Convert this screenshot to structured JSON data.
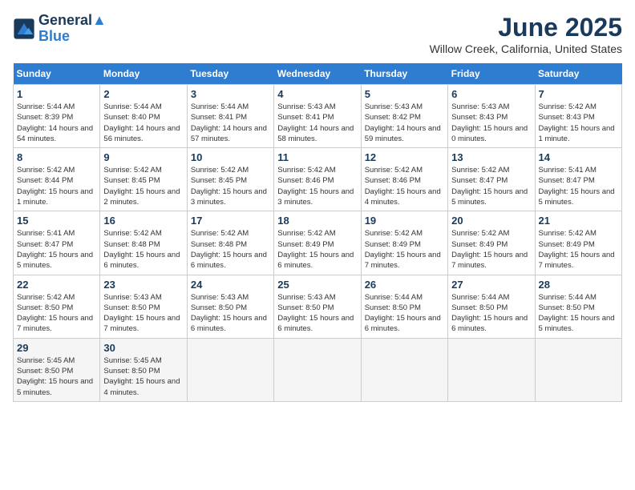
{
  "logo": {
    "line1": "General",
    "line2": "Blue"
  },
  "title": "June 2025",
  "location": "Willow Creek, California, United States",
  "weekdays": [
    "Sunday",
    "Monday",
    "Tuesday",
    "Wednesday",
    "Thursday",
    "Friday",
    "Saturday"
  ],
  "weeks": [
    [
      {
        "day": "1",
        "sunrise": "5:44 AM",
        "sunset": "8:39 PM",
        "daylight": "14 hours and 54 minutes."
      },
      {
        "day": "2",
        "sunrise": "5:44 AM",
        "sunset": "8:40 PM",
        "daylight": "14 hours and 56 minutes."
      },
      {
        "day": "3",
        "sunrise": "5:44 AM",
        "sunset": "8:41 PM",
        "daylight": "14 hours and 57 minutes."
      },
      {
        "day": "4",
        "sunrise": "5:43 AM",
        "sunset": "8:41 PM",
        "daylight": "14 hours and 58 minutes."
      },
      {
        "day": "5",
        "sunrise": "5:43 AM",
        "sunset": "8:42 PM",
        "daylight": "14 hours and 59 minutes."
      },
      {
        "day": "6",
        "sunrise": "5:43 AM",
        "sunset": "8:43 PM",
        "daylight": "15 hours and 0 minutes."
      },
      {
        "day": "7",
        "sunrise": "5:42 AM",
        "sunset": "8:43 PM",
        "daylight": "15 hours and 1 minute."
      }
    ],
    [
      {
        "day": "8",
        "sunrise": "5:42 AM",
        "sunset": "8:44 PM",
        "daylight": "15 hours and 1 minute."
      },
      {
        "day": "9",
        "sunrise": "5:42 AM",
        "sunset": "8:45 PM",
        "daylight": "15 hours and 2 minutes."
      },
      {
        "day": "10",
        "sunrise": "5:42 AM",
        "sunset": "8:45 PM",
        "daylight": "15 hours and 3 minutes."
      },
      {
        "day": "11",
        "sunrise": "5:42 AM",
        "sunset": "8:46 PM",
        "daylight": "15 hours and 3 minutes."
      },
      {
        "day": "12",
        "sunrise": "5:42 AM",
        "sunset": "8:46 PM",
        "daylight": "15 hours and 4 minutes."
      },
      {
        "day": "13",
        "sunrise": "5:42 AM",
        "sunset": "8:47 PM",
        "daylight": "15 hours and 5 minutes."
      },
      {
        "day": "14",
        "sunrise": "5:41 AM",
        "sunset": "8:47 PM",
        "daylight": "15 hours and 5 minutes."
      }
    ],
    [
      {
        "day": "15",
        "sunrise": "5:41 AM",
        "sunset": "8:47 PM",
        "daylight": "15 hours and 5 minutes."
      },
      {
        "day": "16",
        "sunrise": "5:42 AM",
        "sunset": "8:48 PM",
        "daylight": "15 hours and 6 minutes."
      },
      {
        "day": "17",
        "sunrise": "5:42 AM",
        "sunset": "8:48 PM",
        "daylight": "15 hours and 6 minutes."
      },
      {
        "day": "18",
        "sunrise": "5:42 AM",
        "sunset": "8:49 PM",
        "daylight": "15 hours and 6 minutes."
      },
      {
        "day": "19",
        "sunrise": "5:42 AM",
        "sunset": "8:49 PM",
        "daylight": "15 hours and 7 minutes."
      },
      {
        "day": "20",
        "sunrise": "5:42 AM",
        "sunset": "8:49 PM",
        "daylight": "15 hours and 7 minutes."
      },
      {
        "day": "21",
        "sunrise": "5:42 AM",
        "sunset": "8:49 PM",
        "daylight": "15 hours and 7 minutes."
      }
    ],
    [
      {
        "day": "22",
        "sunrise": "5:42 AM",
        "sunset": "8:50 PM",
        "daylight": "15 hours and 7 minutes."
      },
      {
        "day": "23",
        "sunrise": "5:43 AM",
        "sunset": "8:50 PM",
        "daylight": "15 hours and 7 minutes."
      },
      {
        "day": "24",
        "sunrise": "5:43 AM",
        "sunset": "8:50 PM",
        "daylight": "15 hours and 6 minutes."
      },
      {
        "day": "25",
        "sunrise": "5:43 AM",
        "sunset": "8:50 PM",
        "daylight": "15 hours and 6 minutes."
      },
      {
        "day": "26",
        "sunrise": "5:44 AM",
        "sunset": "8:50 PM",
        "daylight": "15 hours and 6 minutes."
      },
      {
        "day": "27",
        "sunrise": "5:44 AM",
        "sunset": "8:50 PM",
        "daylight": "15 hours and 6 minutes."
      },
      {
        "day": "28",
        "sunrise": "5:44 AM",
        "sunset": "8:50 PM",
        "daylight": "15 hours and 5 minutes."
      }
    ],
    [
      {
        "day": "29",
        "sunrise": "5:45 AM",
        "sunset": "8:50 PM",
        "daylight": "15 hours and 5 minutes."
      },
      {
        "day": "30",
        "sunrise": "5:45 AM",
        "sunset": "8:50 PM",
        "daylight": "15 hours and 4 minutes."
      },
      null,
      null,
      null,
      null,
      null
    ]
  ]
}
